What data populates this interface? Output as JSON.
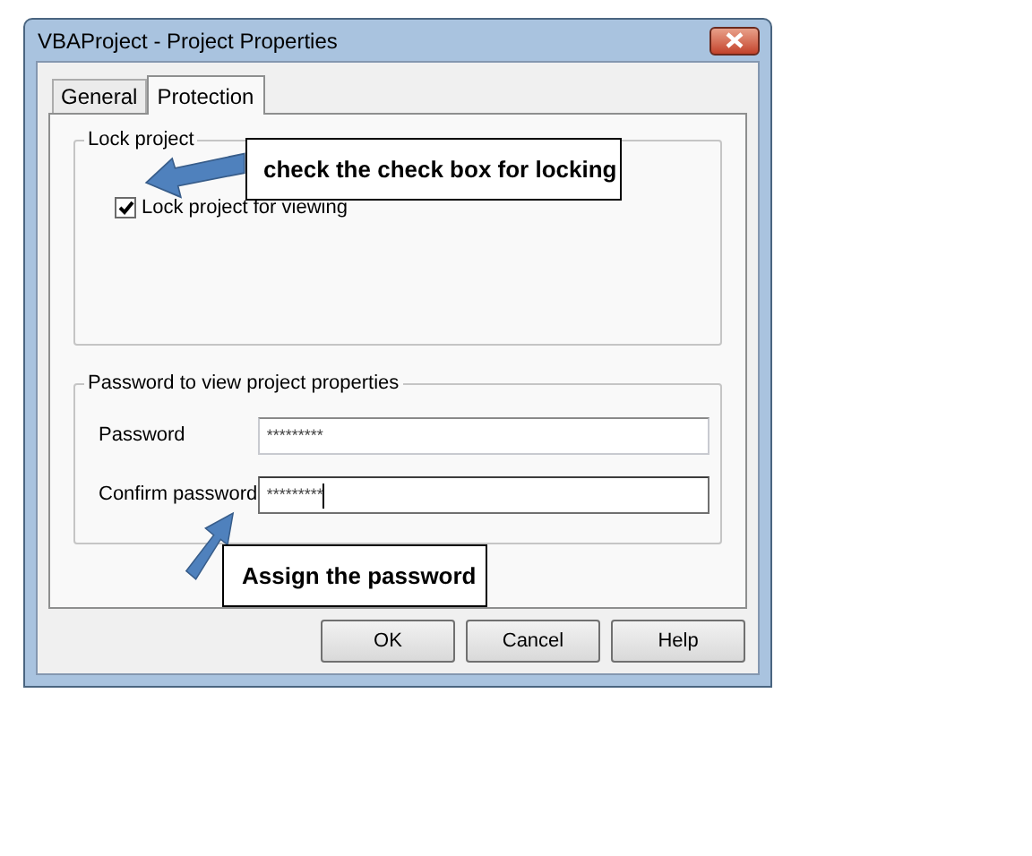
{
  "window": {
    "title": "VBAProject - Project Properties"
  },
  "tabs": [
    {
      "label": "General",
      "selected": false
    },
    {
      "label": "Protection",
      "selected": true
    }
  ],
  "lock_group": {
    "title": "Lock project",
    "checkbox": {
      "label": "Lock project for viewing",
      "checked": true
    }
  },
  "password_group": {
    "title": "Password to view project properties",
    "fields": [
      {
        "label": "Password",
        "value": "*********",
        "focused": false
      },
      {
        "label": "Confirm password",
        "value": "*********",
        "focused": true
      }
    ]
  },
  "buttons": [
    "OK",
    "Cancel",
    "Help"
  ],
  "callouts": [
    "check the check box for locking",
    "Assign the password"
  ]
}
